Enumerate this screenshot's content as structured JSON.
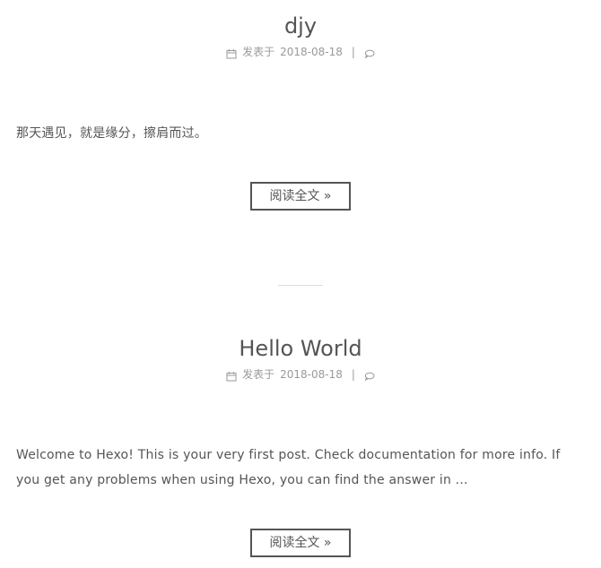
{
  "posts": [
    {
      "title": "djy",
      "meta_label": "发表于",
      "date": "2018-08-18",
      "meta_divider": "|",
      "excerpt": "那天遇见，就是缘分，擦肩而过。",
      "read_more": "阅读全文 »"
    },
    {
      "title": "Hello World",
      "meta_label": "发表于",
      "date": "2018-08-18",
      "meta_divider": "|",
      "excerpt": "Welcome to Hexo! This is your very first post. Check documentation for more info. If you get any problems when using Hexo, you can find the answer in ...",
      "read_more": "阅读全文 »"
    }
  ],
  "icons": {
    "date": "calendar-icon",
    "comments": "comment-icon"
  }
}
